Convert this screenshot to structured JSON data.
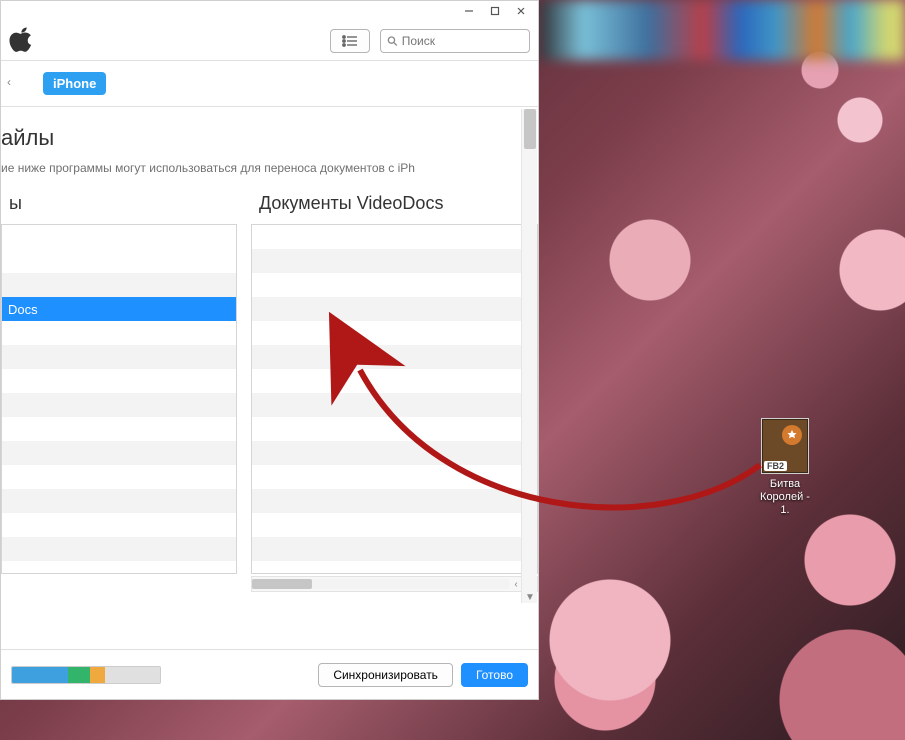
{
  "window": {
    "controls": {
      "min": "–",
      "max": "☐",
      "close": "✕"
    }
  },
  "toolbar": {
    "search_placeholder": "Поиск"
  },
  "devicebar": {
    "device_label": "iPhone",
    "back_char": "‹"
  },
  "filesharing": {
    "title_visible": "айлы",
    "subtitle": "ие ниже программы могут использоваться для переноса документов с iPh"
  },
  "columns": {
    "apps_header": "ы",
    "docs_header": "Документы VideoDocs",
    "apps_items": [
      {
        "label": "",
        "type": "blank"
      },
      {
        "label": "",
        "type": "blank"
      },
      {
        "label": "",
        "type": "alt"
      },
      {
        "label": "Docs",
        "type": "sel"
      },
      {
        "label": "",
        "type": "blank"
      },
      {
        "label": "",
        "type": "alt"
      }
    ],
    "docs_rows": 14
  },
  "bottombar": {
    "sync_label": "Синхронизировать",
    "done_label": "Готово"
  },
  "desktop_file": {
    "ext_badge": "FB2",
    "name": "Битва\nКоролей - 1."
  }
}
